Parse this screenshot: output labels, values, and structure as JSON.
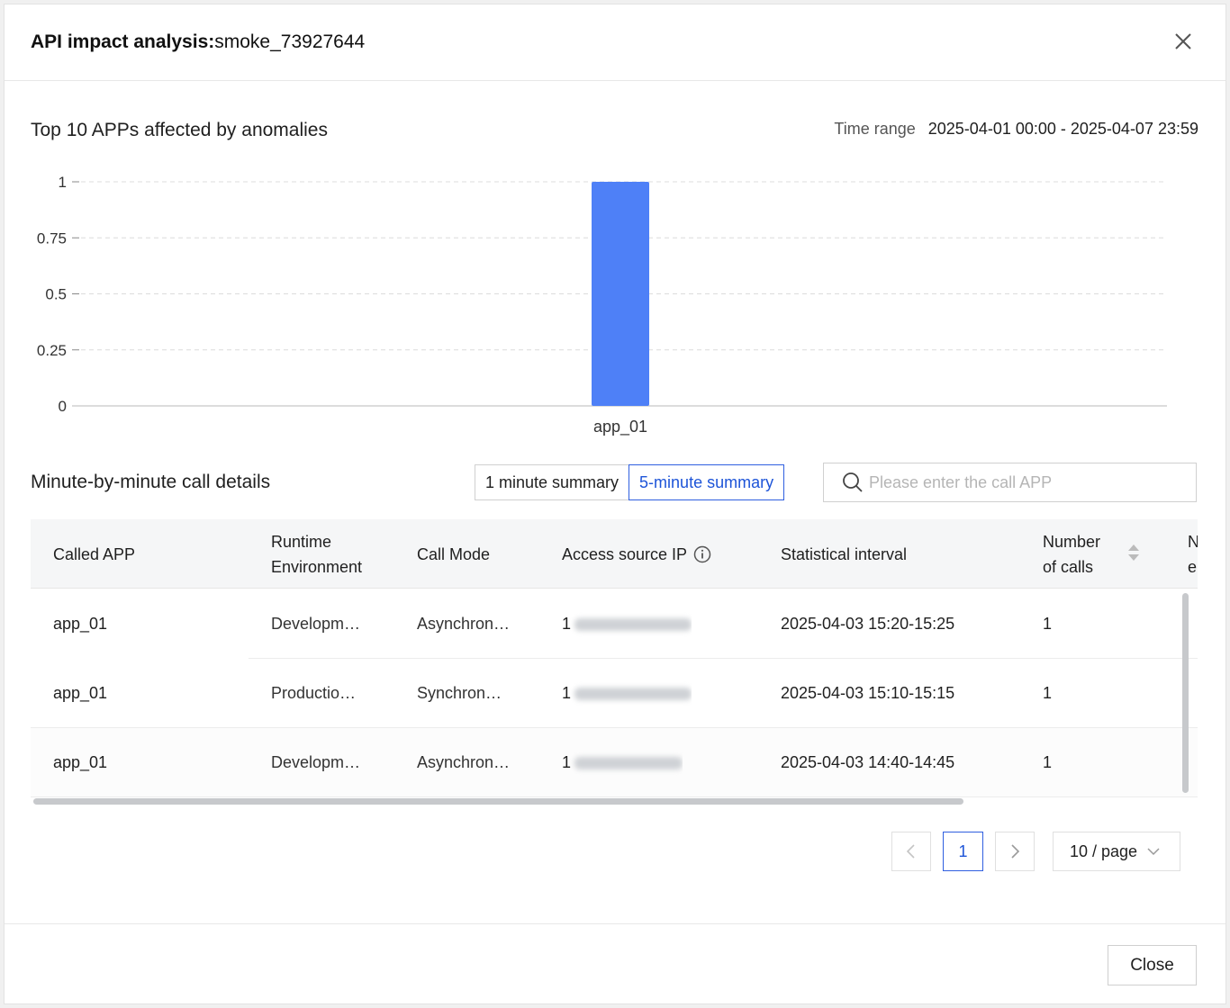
{
  "dialog": {
    "title_prefix": "API impact analysis:",
    "title_name": "smoke_73927644"
  },
  "chart_section": {
    "title": "Top 10 APPs affected by anomalies",
    "time_range_label": "Time range",
    "time_range_value": "2025-04-01 00:00 - 2025-04-07 23:59"
  },
  "chart_data": {
    "type": "bar",
    "categories": [
      "app_01"
    ],
    "values": [
      1
    ],
    "ylim": [
      0,
      1
    ],
    "yticks": [
      "0",
      "0.25",
      "0.5",
      "0.75",
      "1"
    ],
    "grid": true,
    "bar_color": "#4e80f7"
  },
  "details": {
    "title": "Minute-by-minute call details",
    "tab_1min": "1 minute summary",
    "tab_5min": "5-minute summary",
    "search_placeholder": "Please enter the call APP"
  },
  "table": {
    "headers": {
      "called_app": "Called APP",
      "runtime_1": "Runtime",
      "runtime_2": "Environment",
      "call_mode": "Call Mode",
      "source_ip": "Access source IP",
      "interval": "Statistical interval",
      "calls_1": "Number",
      "calls_2": "of calls",
      "next_1": "N",
      "next_2": "e"
    },
    "rows": [
      {
        "app": "app_01",
        "env": "Developm…",
        "mode": "Asynchron…",
        "ip": "1",
        "interval": "2025-04-03 15:20-15:25",
        "calls": "1"
      },
      {
        "app": "app_01",
        "env": "Productio…",
        "mode": "Synchron…",
        "ip": "1",
        "interval": "2025-04-03 15:10-15:15",
        "calls": "1"
      },
      {
        "app": "app_01",
        "env": "Developm…",
        "mode": "Asynchron…",
        "ip": "1",
        "interval": "2025-04-03 14:40-14:45",
        "calls": "1"
      }
    ]
  },
  "pagination": {
    "current": "1",
    "page_size": "10 / page"
  },
  "footer": {
    "close_label": "Close"
  },
  "colors": {
    "accent": "#1d54d8",
    "bar": "#4e80f7"
  }
}
